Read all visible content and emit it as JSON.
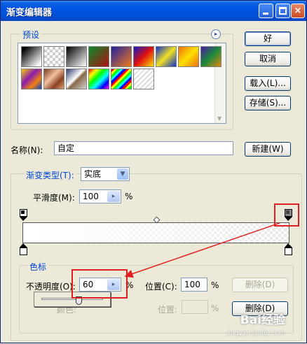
{
  "window": {
    "title": "渐变编辑器",
    "controls": {
      "minimize": "minimize-icon",
      "maximize": "maximize-icon",
      "close": "×"
    }
  },
  "presets": {
    "label": "预设",
    "menu_icon": "▸",
    "swatches": [
      {
        "name": "black-white",
        "css": "linear-gradient(135deg,#000 10%,#fff 90%)"
      },
      {
        "name": "checker-white",
        "css": "transparent"
      },
      {
        "name": "black-white-transparent",
        "css": "linear-gradient(135deg,#000 0%,#fff 100%)"
      },
      {
        "name": "red-green",
        "css": "linear-gradient(135deg,#0a8a2a 0%,#b01010 100%)"
      },
      {
        "name": "violet-orange",
        "css": "linear-gradient(135deg,#2020a0 0%,#f07a1a 100%)"
      },
      {
        "name": "blue-red-yellow",
        "css": "linear-gradient(135deg,#1018c8 0%,#e01010 50%,#f8e000 100%)"
      },
      {
        "name": "blue-yellow-blue",
        "css": "linear-gradient(135deg,#1030d0 0%,#f0e020 50%,#1030d0 100%)"
      },
      {
        "name": "orange-yellow-orange",
        "css": "linear-gradient(135deg,#f07010 0%,#ffe000 50%,#f07010 100%)"
      },
      {
        "name": "violet-green-orange",
        "css": "linear-gradient(135deg,#4a1aa0 0%,#1a8a3a 50%,#e08a10 100%)"
      },
      {
        "name": "yellow-violet-orange-blue",
        "css": "linear-gradient(135deg,#f8d000 0%,#8a1ab0 40%,#f08010 70%,#1040c0 100%)"
      },
      {
        "name": "copper",
        "css": "linear-gradient(135deg,#7a3a1a 0%,#f0c0a0 40%,#8a4020 70%,#e0a070 100%)"
      },
      {
        "name": "chrome",
        "css": "linear-gradient(135deg,#2a3a6a 0%,#fff 45%,#8a6a4a 55%,#d0d0d0 100%)"
      },
      {
        "name": "spectrum",
        "css": "linear-gradient(135deg,#f00 0%,#ff0 20%,#0f0 40%,#0ff 60%,#00f 80%,#f0f 100%)"
      },
      {
        "name": "transparent-rainbow",
        "css": "repeating-linear-gradient(135deg,#f00 0 3px,#ff0 3px 6px,#0f0 6px 9px,#0ff 9px 12px,#00f 12px 15px)"
      },
      {
        "name": "transparent-stripes",
        "css": "repeating-linear-gradient(135deg,#ddd 0 2px,#fff 2px 5px)"
      }
    ]
  },
  "buttons": {
    "ok": "好",
    "cancel": "取消",
    "load": "载入(L)...",
    "save": "存储(S)...",
    "new": "新建(W)",
    "delete": "删除(D)",
    "delete2": "删除(D)"
  },
  "name_field": {
    "label": "名称(N):",
    "value": "自定"
  },
  "gradient": {
    "group_label": "渐变类型(T):",
    "type_value": "实底",
    "smoothness_label": "平滑度(M):",
    "smoothness_value": "100",
    "percent": "%"
  },
  "stops": {
    "group_label": "色标",
    "opacity_label": "不透明度(O):",
    "opacity_value": "60",
    "opacity_percent": "%",
    "location_label": "位置(C):",
    "location_value": "100",
    "location_percent": "%",
    "color_label": "颜色:",
    "color_location_label": "位置:",
    "color_location_percent": "%",
    "opacity_slider_fraction": 0.6
  },
  "watermark": {
    "text": "Bai经验",
    "sub": "jingyan.baidu.com"
  }
}
